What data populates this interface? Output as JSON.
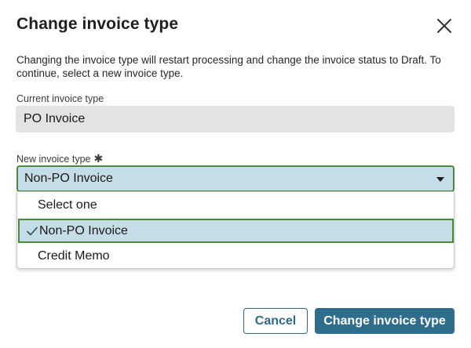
{
  "dialog": {
    "title": "Change invoice type",
    "description": "Changing the invoice type will restart processing and change the invoice status to Draft. To continue, select a new invoice type.",
    "close_icon": "close-icon"
  },
  "current_type": {
    "label": "Current invoice type",
    "value": "PO Invoice"
  },
  "new_type": {
    "label": "New invoice type",
    "required_marker": "✱",
    "selected_value": "Non-PO Invoice",
    "caret_icon": "caret-down-icon",
    "options": [
      {
        "label": "Select one",
        "selected": false
      },
      {
        "label": "Non-PO Invoice",
        "selected": true
      },
      {
        "label": "Credit Memo",
        "selected": false
      }
    ],
    "check_icon": "checkmark-icon"
  },
  "footer": {
    "cancel_label": "Cancel",
    "submit_label": "Change invoice type"
  },
  "colors": {
    "primary": "#2f6d8c",
    "selection_bg": "#c5dde6",
    "focus_border": "#4b8a3c",
    "readonly_bg": "#e1e3e4"
  }
}
